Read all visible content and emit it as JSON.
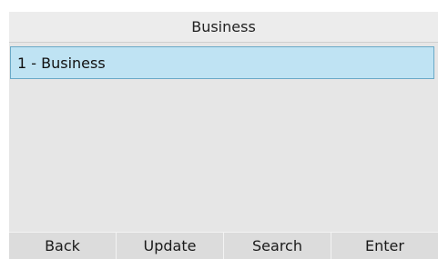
{
  "header": {
    "title": "Business"
  },
  "list": {
    "items": [
      {
        "label": "1 - Business",
        "selected": true
      }
    ]
  },
  "softkeys": [
    {
      "label": "Back"
    },
    {
      "label": "Update"
    },
    {
      "label": "Search"
    },
    {
      "label": "Enter"
    }
  ],
  "colors": {
    "screen_background": "#e6e6e6",
    "selection_fill": "#bfe3f3",
    "selection_border": "#6aa9c7"
  }
}
